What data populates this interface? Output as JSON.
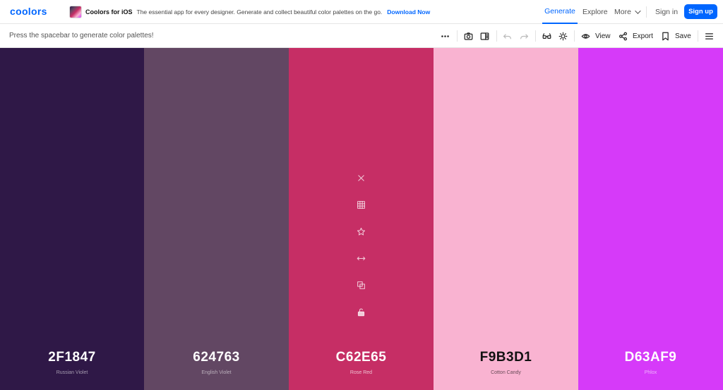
{
  "header": {
    "logo": "coolors",
    "promo": {
      "title": "Coolors for iOS",
      "text": "The essential app for every designer. Generate and collect beautiful color palettes on the go.",
      "link": "Download Now"
    },
    "nav": {
      "generate": "Generate",
      "explore": "Explore",
      "more": "More",
      "sign_in": "Sign in",
      "sign_up": "Sign up"
    }
  },
  "toolbar": {
    "hint": "Press the spacebar to generate color palettes!",
    "view": "View",
    "export": "Export",
    "save": "Save"
  },
  "palette": [
    {
      "hex": "2F1847",
      "name": "Russian Violet",
      "color": "#2F1847",
      "text_color": "#ffffff",
      "name_color": "rgba(255,255,255,0.55)"
    },
    {
      "hex": "624763",
      "name": "English Violet",
      "color": "#624763",
      "text_color": "#ffffff",
      "name_color": "rgba(255,255,255,0.55)"
    },
    {
      "hex": "C62E65",
      "name": "Rose Red",
      "color": "#C62E65",
      "text_color": "#ffffff",
      "name_color": "rgba(255,255,255,0.7)"
    },
    {
      "hex": "F9B3D1",
      "name": "Cotton Candy",
      "color": "#F9B3D1",
      "text_color": "#111111",
      "name_color": "rgba(0,0,0,0.6)"
    },
    {
      "hex": "D63AF9",
      "name": "Phlox",
      "color": "#D63AF9",
      "text_color": "#ffffff",
      "name_color": "rgba(255,255,255,0.6)"
    }
  ],
  "hovered_swatch_tools": [
    "close-icon",
    "grid-icon",
    "star-icon",
    "drag-arrows-icon",
    "copy-icon",
    "unlock-icon"
  ],
  "colors": {
    "accent": "#0066ff"
  }
}
